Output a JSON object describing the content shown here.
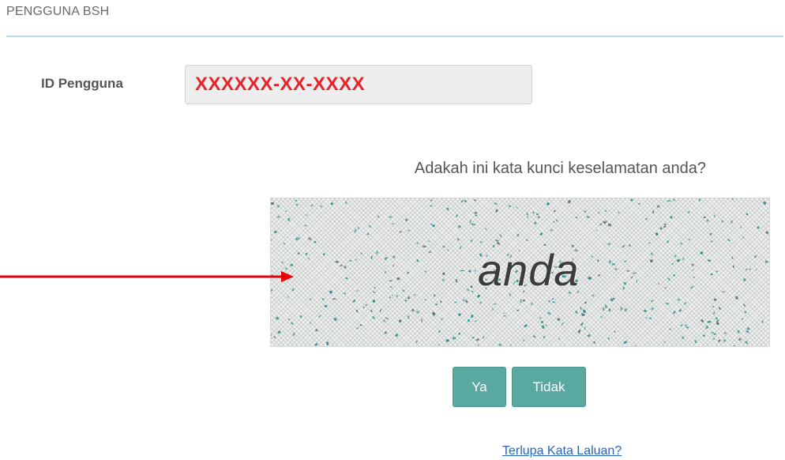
{
  "section": {
    "title": "PENGGUNA BSH"
  },
  "user_id": {
    "label": "ID Pengguna",
    "value": "XXXXXX-XX-XXXX"
  },
  "security": {
    "question": "Adakah ini kata kunci keselamatan anda?",
    "captcha_word": "anda"
  },
  "actions": {
    "yes_label": "Ya",
    "no_label": "Tidak"
  },
  "links": {
    "forgot_password": "Terlupa Kata Laluan?"
  },
  "colors": {
    "accent": "#5aa9a1",
    "id_value": "#e8242b",
    "annotation_arrow": "#e8000b",
    "link": "#2a64b5",
    "captcha_dots": "#2f8f8a"
  }
}
